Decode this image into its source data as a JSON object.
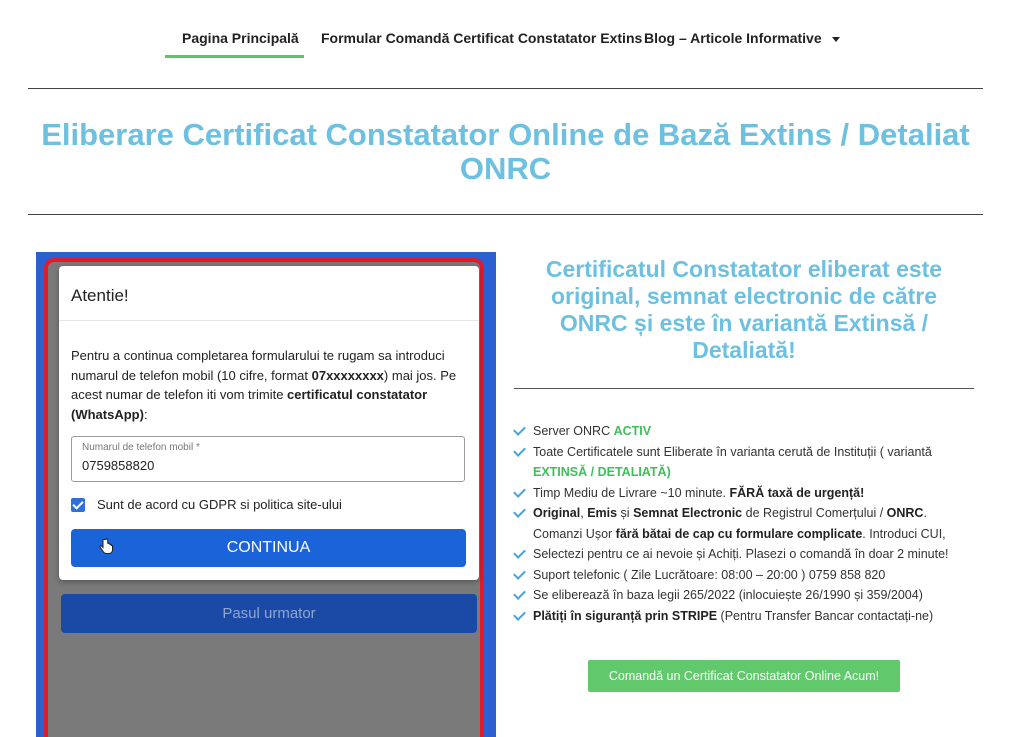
{
  "nav": {
    "items": [
      {
        "label": "Pagina Principală"
      },
      {
        "label": "Formular Comandă Certificat Constatator Extins"
      },
      {
        "label": "Blog – Articole Informative"
      }
    ]
  },
  "hero": {
    "title_line1": "Eliberare Certificat Constatator Online de Bază Extins / Detaliat",
    "title_line2": "ONRC"
  },
  "modal": {
    "title": "Atentie!",
    "text_part1": "Pentru a continua completarea formularului te rugam sa introduci numarul de telefon mobil (10 cifre, format ",
    "text_format": "07xxxxxxxx",
    "text_part2": ") mai jos. Pe acest numar de telefon iti vom trimite ",
    "text_bold2": "certificatul constatator (WhatsApp)",
    "text_part3": ":",
    "phone_label": "Numarul de telefon mobil *",
    "phone_value": "0759858820",
    "gdpr_label": "Sunt de acord cu GDPR si politica site-ului",
    "continue_label": "CONTINUA"
  },
  "next_step_label": "Pasul urmator",
  "right": {
    "subtitle": "Certificatul Constatator eliberat este original, semnat electronic de către ONRC și este în variantă Extinsă / Detaliată!",
    "features": {
      "f1_text": "Server ONRC ",
      "f1_status": "ACTIV",
      "f2_text": "Toate Certificatele sunt Eliberate în varianta cerută de Instituții ( variantă ",
      "f2_variant": "EXTINSĂ / DETALIATĂ)",
      "f3_text": "Timp Mediu de Livrare ~10 minute. ",
      "f3_bold": "FĂRĂ taxă de urgență!",
      "f4_b1": "Original",
      "f4_t1": ", ",
      "f4_b2": "Emis",
      "f4_t2": " și ",
      "f4_b3": "Semnat Electronic",
      "f4_t3": " de Registrul Comerțului / ",
      "f4_b4": "ONRC",
      "f4_t4": ". Comanzi Ușor ",
      "f4_b5": "fără bătai de cap cu formulare complicate",
      "f4_t5": ". Introduci CUI,",
      "f5_text": "Selectezi pentru ce ai nevoie și Achiți. Plasezi o comandă în doar 2 minute!",
      "f6_text": "Suport telefonic ( Zile Lucrătoare: 08:00 – 20:00 ) 0759 858 820",
      "f7_text": "Se eliberează în baza legii 265/2022 (inlocuiește 26/1990 și 359/2004)",
      "f8_bold": "Plătiți în siguranță prin STRIPE",
      "f8_text": " (Pentru Transfer Bancar contactați-ne)"
    },
    "cta_label": "Comandă un Certificat Constatator Online Acum!"
  },
  "colors": {
    "accent_blue": "#6dc0e0",
    "button_blue": "#1a63d8",
    "green": "#61c96c",
    "red_frame": "#e01b2a"
  },
  "icons": [
    "chevron-down-icon",
    "checkmark-icon",
    "hand-cursor-icon",
    "checkbox-icon"
  ]
}
